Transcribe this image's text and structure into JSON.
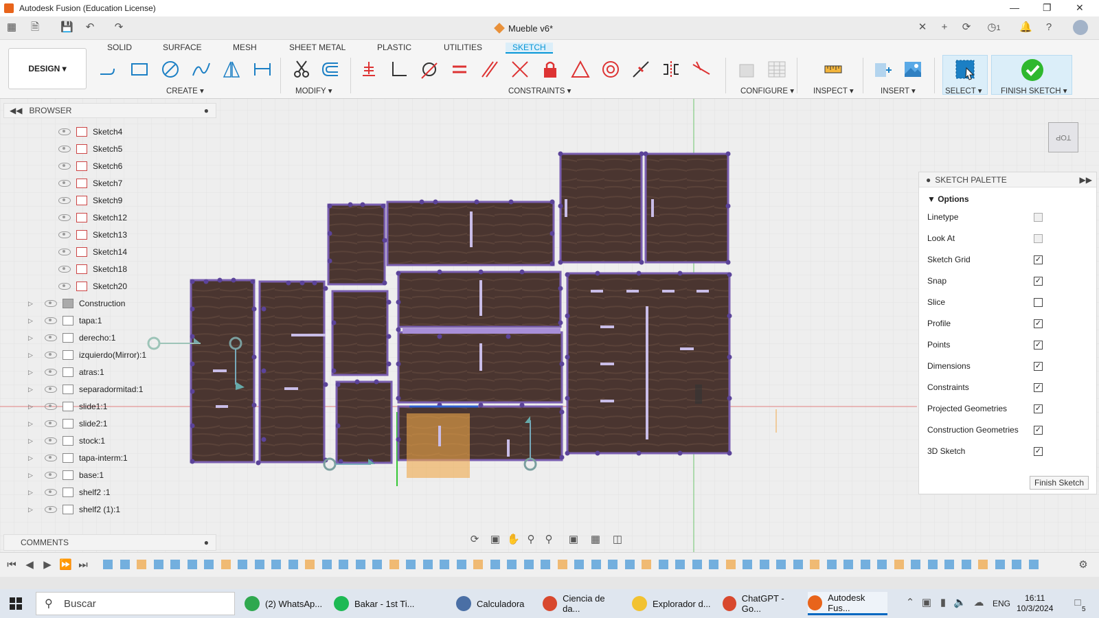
{
  "window": {
    "title": "Autodesk Fusion (Education License)"
  },
  "document": {
    "tab_title": "Mueble v6*",
    "jobs": "1"
  },
  "workspace": {
    "design_label": "DESIGN ▾"
  },
  "tabs": [
    {
      "label": "SOLID"
    },
    {
      "label": "SURFACE"
    },
    {
      "label": "MESH"
    },
    {
      "label": "SHEET METAL"
    },
    {
      "label": "PLASTIC"
    },
    {
      "label": "UTILITIES"
    },
    {
      "label": "SKETCH"
    }
  ],
  "groups": {
    "create": "CREATE ▾",
    "modify": "MODIFY ▾",
    "constraints": "CONSTRAINTS ▾",
    "configure": "CONFIGURE ▾",
    "inspect": "INSPECT ▾",
    "insert": "INSERT ▾",
    "select": "SELECT ▾",
    "finish": "FINISH SKETCH ▾"
  },
  "browser": {
    "title": "BROWSER",
    "items": [
      {
        "label": "Sketch4",
        "type": "sketch"
      },
      {
        "label": "Sketch5",
        "type": "sketch"
      },
      {
        "label": "Sketch6",
        "type": "sketch"
      },
      {
        "label": "Sketch7",
        "type": "sketch"
      },
      {
        "label": "Sketch9",
        "type": "sketch"
      },
      {
        "label": "Sketch12",
        "type": "sketch"
      },
      {
        "label": "Sketch13",
        "type": "sketch"
      },
      {
        "label": "Sketch14",
        "type": "sketch"
      },
      {
        "label": "Sketch18",
        "type": "sketch"
      },
      {
        "label": "Sketch20",
        "type": "sketch"
      },
      {
        "label": "Construction",
        "type": "folder"
      },
      {
        "label": "tapa:1",
        "type": "body"
      },
      {
        "label": "derecho:1",
        "type": "body"
      },
      {
        "label": "izquierdo(Mirror):1",
        "type": "body"
      },
      {
        "label": "atras:1",
        "type": "body"
      },
      {
        "label": "separadormitad:1",
        "type": "body"
      },
      {
        "label": "slide1:1",
        "type": "body"
      },
      {
        "label": "slide2:1",
        "type": "body"
      },
      {
        "label": "stock:1",
        "type": "body"
      },
      {
        "label": "tapa-interm:1",
        "type": "body"
      },
      {
        "label": "base:1",
        "type": "body"
      },
      {
        "label": "shelf2 :1",
        "type": "body"
      },
      {
        "label": "shelf2 (1):1",
        "type": "body"
      }
    ]
  },
  "comments": {
    "title": "COMMENTS"
  },
  "viewcube": {
    "label": "TOP"
  },
  "palette": {
    "title": "SKETCH PALETTE",
    "section": "Options",
    "rows": [
      {
        "label": "Linetype",
        "kind": "icons"
      },
      {
        "label": "Look At",
        "kind": "icon"
      },
      {
        "label": "Sketch Grid",
        "checked": true
      },
      {
        "label": "Snap",
        "checked": true
      },
      {
        "label": "Slice",
        "checked": false
      },
      {
        "label": "Profile",
        "checked": true
      },
      {
        "label": "Points",
        "checked": true
      },
      {
        "label": "Dimensions",
        "checked": true
      },
      {
        "label": "Constraints",
        "checked": true
      },
      {
        "label": "Projected Geometries",
        "checked": true
      },
      {
        "label": "Construction Geometries",
        "checked": true
      },
      {
        "label": "3D Sketch",
        "checked": true
      }
    ],
    "finish_label": "Finish Sketch"
  },
  "taskbar": {
    "search_placeholder": "Buscar",
    "apps": [
      {
        "label": "(2) WhatsAp...",
        "color": "#2fa84f"
      },
      {
        "label": "Bakar - 1st Ti...",
        "color": "#1db954"
      },
      {
        "label": "Calculadora",
        "color": "#4a6fa5"
      },
      {
        "label": "Ciencia de da...",
        "color": "#d8482e"
      },
      {
        "label": "Explorador d...",
        "color": "#f2c230"
      },
      {
        "label": "ChatGPT - Go...",
        "color": "#d8482e"
      },
      {
        "label": "Autodesk Fus...",
        "color": "#e8641b"
      }
    ],
    "lang": "ENG",
    "time": "16:11",
    "date": "10/3/2024",
    "notifications": "5"
  },
  "colors": {
    "accent": "#0696d7",
    "wood": "#4a3530",
    "sketch_line": "#7a5fb0",
    "finish_green": "#2eb82e"
  }
}
